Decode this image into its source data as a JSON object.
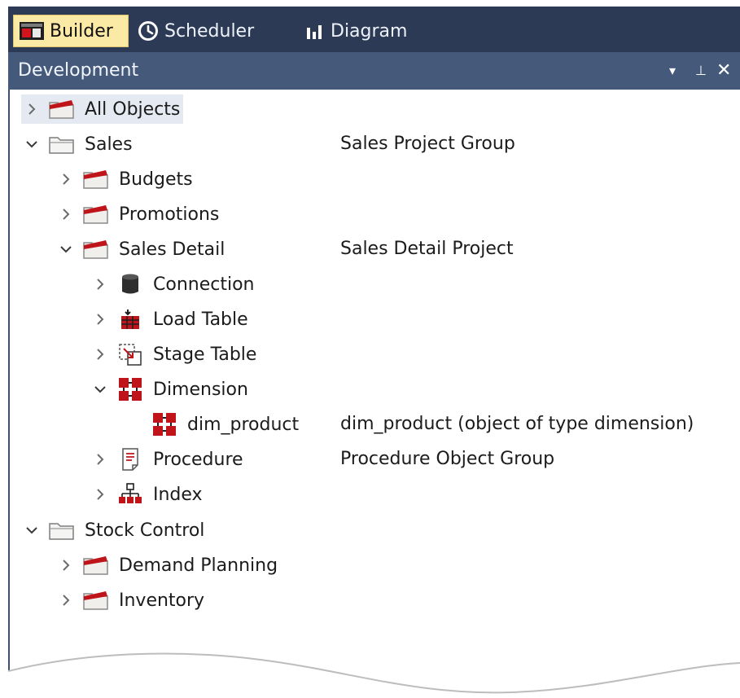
{
  "tabs": [
    {
      "label": "Builder",
      "icon": "builder-icon",
      "active": true
    },
    {
      "label": "Scheduler",
      "icon": "clock-icon",
      "active": false
    },
    {
      "label": "Diagram",
      "icon": "bar-chart-icon",
      "active": false
    }
  ],
  "panel": {
    "title": "Development",
    "buttons": {
      "dropdown": "▾",
      "pin": "⊥",
      "close": "✕"
    }
  },
  "tree": [
    {
      "label": "All Objects",
      "description": "",
      "icon": "folder-red-icon",
      "expanded": false,
      "selected": true
    },
    {
      "label": "Sales",
      "description": "Sales Project Group",
      "icon": "folder-plain-icon",
      "expanded": true
    },
    {
      "label": "Budgets",
      "description": "",
      "icon": "folder-red-icon",
      "expanded": false
    },
    {
      "label": "Promotions",
      "description": "",
      "icon": "folder-red-icon",
      "expanded": false
    },
    {
      "label": "Sales Detail",
      "description": "Sales Detail Project",
      "icon": "folder-red-icon",
      "expanded": true
    },
    {
      "label": "Connection",
      "description": "",
      "icon": "database-icon",
      "expanded": false
    },
    {
      "label": "Load Table",
      "description": "",
      "icon": "load-table-icon",
      "expanded": false
    },
    {
      "label": "Stage Table",
      "description": "",
      "icon": "stage-table-icon",
      "expanded": false
    },
    {
      "label": "Dimension",
      "description": "",
      "icon": "dimension-icon",
      "expanded": true
    },
    {
      "label": "dim_product",
      "description": "dim_product (object of type dimension)",
      "icon": "dimension-icon"
    },
    {
      "label": "Procedure",
      "description": "Procedure Object Group",
      "icon": "procedure-icon",
      "expanded": false
    },
    {
      "label": "Index",
      "description": "",
      "icon": "index-icon",
      "expanded": false
    },
    {
      "label": "Stock Control",
      "description": "",
      "icon": "folder-plain-icon",
      "expanded": true
    },
    {
      "label": "Demand Planning",
      "description": "",
      "icon": "folder-red-icon",
      "expanded": false
    },
    {
      "label": "Inventory",
      "description": "",
      "icon": "folder-red-icon",
      "expanded": false
    }
  ],
  "colors": {
    "tabbar": "#2c3a55",
    "panel_header": "#45597b",
    "active_tab": "#fbe9a6",
    "icon_red": "#c0141b"
  }
}
